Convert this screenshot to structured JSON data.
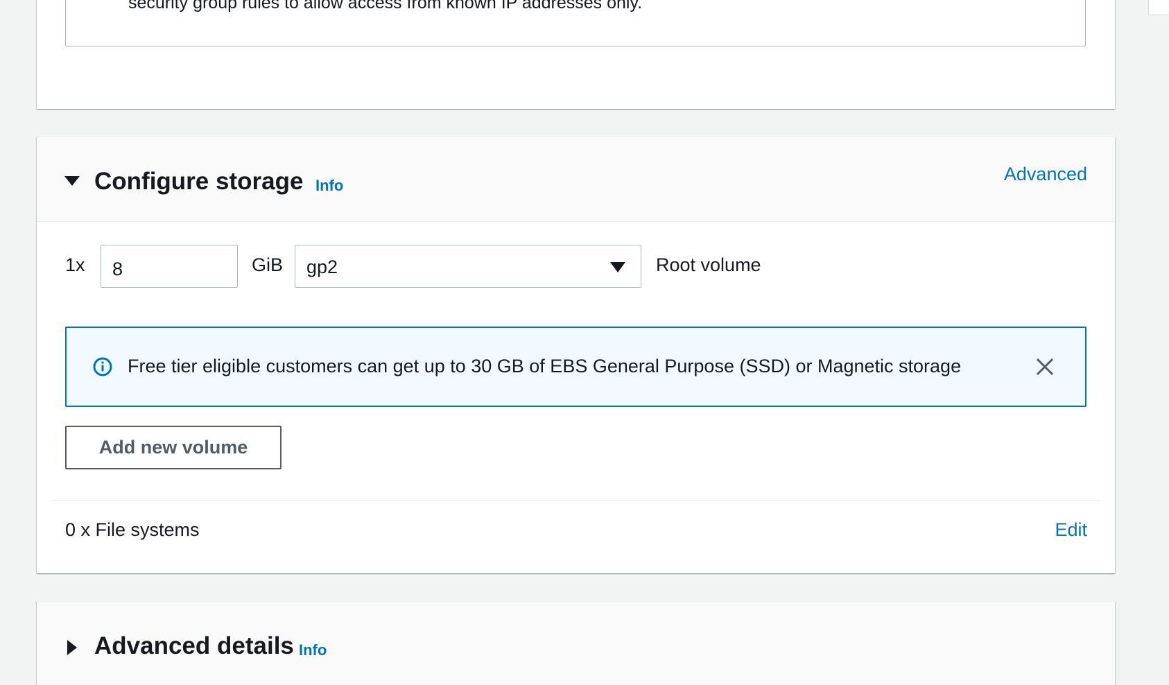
{
  "security_panel": {
    "warning_text": "security group rules to allow access from known IP addresses only."
  },
  "storage_panel": {
    "title": "Configure storage",
    "info_label": "Info",
    "advanced_label": "Advanced",
    "volume": {
      "count_label": "1x",
      "size_value": "8",
      "unit_label": "GiB",
      "type_value": "gp2",
      "role_label": "Root volume"
    },
    "alert": {
      "text": "Free tier eligible customers can get up to 30 GB of EBS General Purpose (SSD) or Magnetic storage",
      "icon": "info-circle-icon",
      "close_icon": "close-icon"
    },
    "add_volume_label": "Add new volume",
    "file_systems_label": "0 x File systems",
    "edit_label": "Edit"
  },
  "advanced_panel": {
    "title": "Advanced details",
    "info_label": "Info"
  },
  "colors": {
    "link": "#0073bb",
    "alert_border": "#0073bb",
    "alert_bg": "#f1faff",
    "page_bg": "#f2f3f3",
    "text": "#16191f",
    "button_text": "#545b64"
  }
}
